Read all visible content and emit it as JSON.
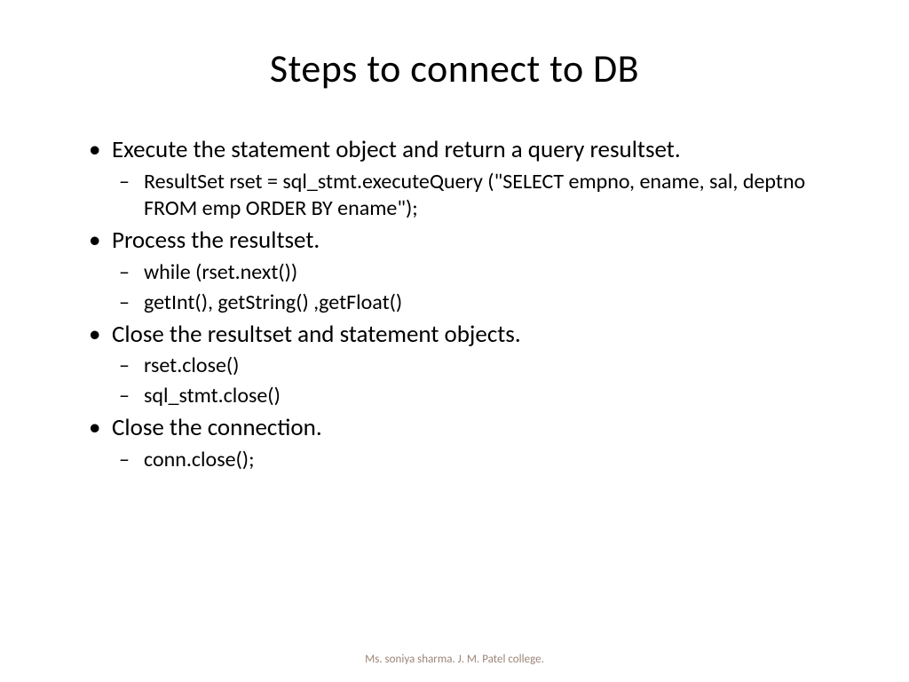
{
  "title": "Steps to connect to DB",
  "bullets": [
    {
      "text": "Execute the statement object and return a query resultset.",
      "sub": [
        "ResultSet rset = sql_stmt.executeQuery (\"SELECT empno, ename, sal, deptno FROM emp ORDER BY ename\");"
      ]
    },
    {
      "text": "Process the resultset.",
      "sub": [
        "while (rset.next())",
        " getInt(), getString() ,getFloat()"
      ]
    },
    {
      "text": "Close the resultset and statement objects.",
      "sub": [
        "rset.close()",
        " sql_stmt.close()"
      ]
    },
    {
      "text": "Close the connection.",
      "sub": [
        "conn.close();"
      ]
    }
  ],
  "footer": "Ms. soniya sharma. J. M. Patel college."
}
